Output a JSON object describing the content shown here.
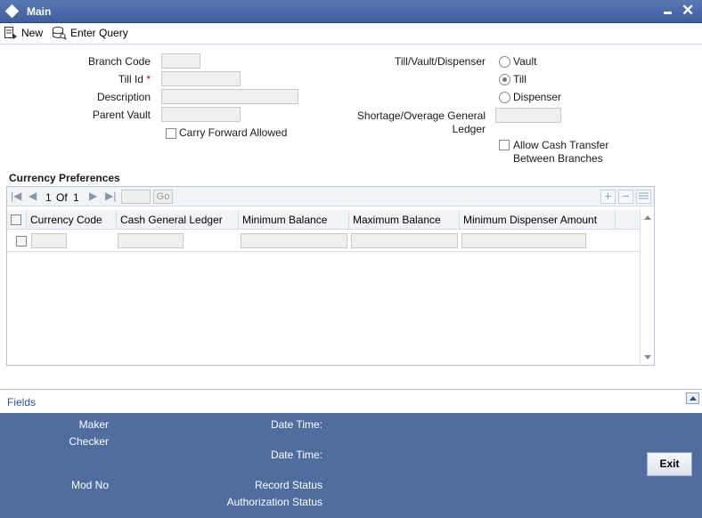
{
  "window": {
    "title": "Main"
  },
  "toolbar": {
    "new_label": "New",
    "enter_query_label": "Enter Query"
  },
  "form": {
    "branch_code_label": "Branch Code",
    "till_id_label": "Till Id",
    "required_marker": "*",
    "description_label": "Description",
    "parent_vault_label": "Parent Vault",
    "carry_forward_label": "Carry Forward Allowed",
    "till_vault_dispenser_label": "Till/Vault/Dispenser",
    "radio_vault": "Vault",
    "radio_till": "Till",
    "radio_dispenser": "Dispenser",
    "selected_type": "Till",
    "shortage_label_line1": "Shortage/Overage General",
    "shortage_label_line2": "Ledger",
    "allow_cash_transfer_line1": "Allow Cash Transfer",
    "allow_cash_transfer_line2": "Between Branches"
  },
  "currency_preferences": {
    "title": "Currency Preferences",
    "pager": {
      "current": "1",
      "of_label": "Of",
      "total": "1",
      "go_label": "Go"
    },
    "columns": [
      "Currency Code",
      "Cash General Ledger",
      "Minimum Balance",
      "Maximum Balance",
      "Minimum Dispenser Amount"
    ]
  },
  "fields_bar": {
    "label": "Fields"
  },
  "footer": {
    "maker_label": "Maker",
    "checker_label": "Checker",
    "date_time_label": "Date Time:",
    "mod_no_label": "Mod No",
    "record_status_label": "Record Status",
    "authorization_status_label": "Authorization Status",
    "exit_label": "Exit"
  },
  "colors": {
    "titlebar": "#4a6aa8",
    "footer": "#4f6d9f",
    "link": "#2b55a0"
  }
}
